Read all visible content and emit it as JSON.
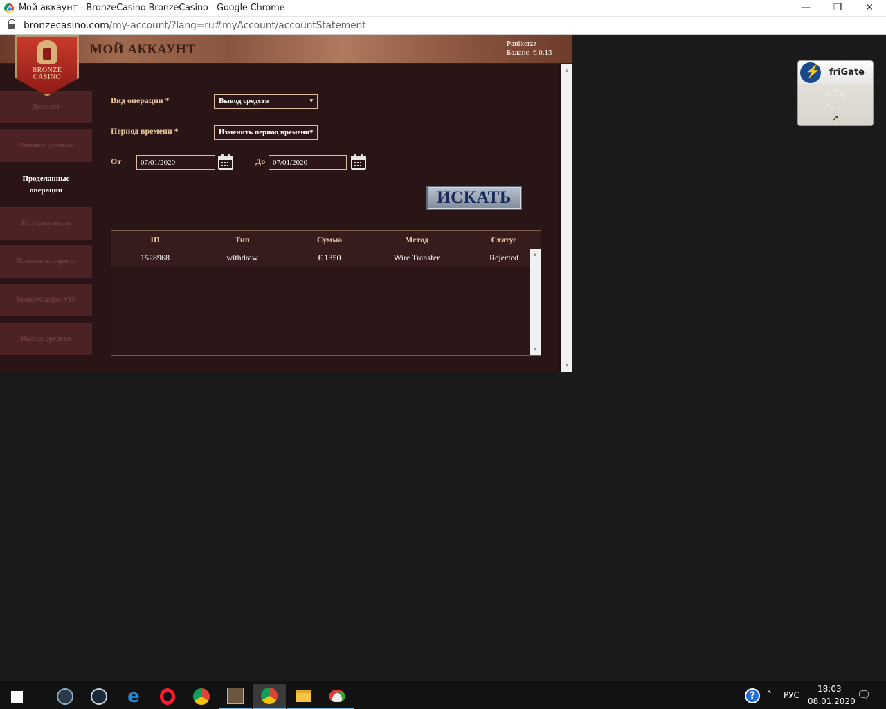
{
  "browser": {
    "window_title": "Мой аккаунт - BronzeCasino BronzeCasino - Google Chrome",
    "url_domain": "bronzecasino.com",
    "url_path": "/my-account/?lang=ru#myAccount/accountStatement",
    "minimize": "—",
    "restore": "❐",
    "close": "✕"
  },
  "header": {
    "page_title": "МОЙ АККАУНТ",
    "username": "Panikerzz",
    "balance_label": "Баланс",
    "balance_value": "€ 0.13"
  },
  "logo": {
    "line1": "BRONZE",
    "line2": "CASINO"
  },
  "sidebar": {
    "items": [
      {
        "label": "Депозит"
      },
      {
        "label": "Личные данные"
      },
      {
        "label": "Проделанные операции"
      },
      {
        "label": "История игры"
      },
      {
        "label": "Изменить пароль"
      },
      {
        "label": "BronzeCasino VIP"
      },
      {
        "label": "Вывод средств"
      }
    ],
    "active_index": 2
  },
  "form": {
    "operation_type_label": "Вид операции *",
    "operation_type_value": "Вывод средств",
    "period_label": "Период времени *",
    "period_value": "Изменить период времени",
    "from_label": "От",
    "from_value": "07/01/2020",
    "to_label": "До",
    "to_value": "07/01/2020",
    "search_button": "ИСКАТЬ"
  },
  "table": {
    "headers": [
      "ID",
      "Тип",
      "Сумма",
      "Метод",
      "Статус"
    ],
    "rows": [
      [
        "1528968",
        "withdraw",
        "€ 1350",
        "Wire Transfer",
        "Rejected"
      ]
    ]
  },
  "frigate": {
    "name": "friGate"
  },
  "taskbar": {
    "icons": [
      "windows-start",
      "support-agent",
      "steam",
      "edge",
      "opera",
      "chrome",
      "game-app",
      "chrome-active",
      "file-explorer",
      "paint"
    ],
    "language": "РУС",
    "time": "18:03",
    "date": "08.01.2020"
  }
}
